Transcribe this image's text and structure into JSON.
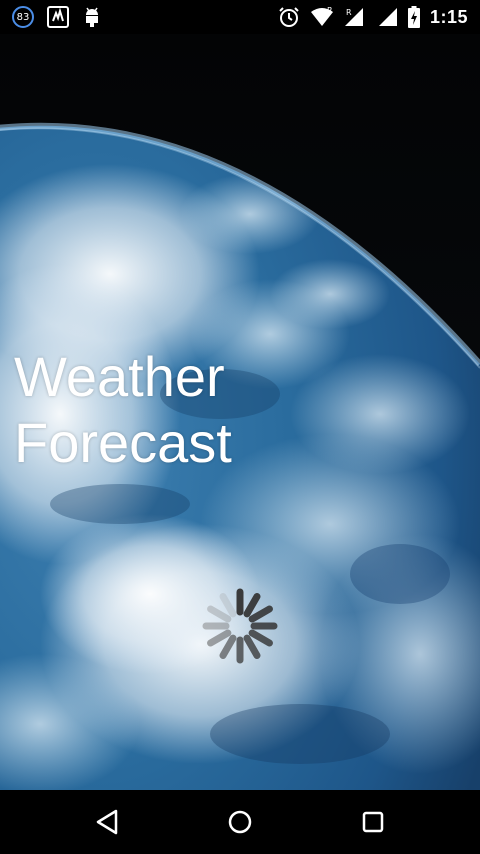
{
  "app": {
    "title_line1": "Weather",
    "title_line2": "Forecast"
  },
  "status_bar": {
    "notification_count": "83",
    "time": "1:15",
    "roaming_indicator_1": "R",
    "roaming_indicator_2": "R",
    "icons": [
      "notification-count-icon",
      "voicemail-icon",
      "android-debug-icon",
      "alarm-icon",
      "wifi-icon",
      "signal-icon",
      "signal-icon",
      "battery-charging-icon"
    ]
  },
  "nav_bar": {
    "icons": [
      "back-icon",
      "home-icon",
      "recents-icon"
    ]
  },
  "colors": {
    "status_bar_bg": "#000000",
    "nav_bar_bg": "#000000",
    "title_text": "#ffffff",
    "ocean": "#2a6fa5",
    "spinner": "#3c3c3c"
  }
}
